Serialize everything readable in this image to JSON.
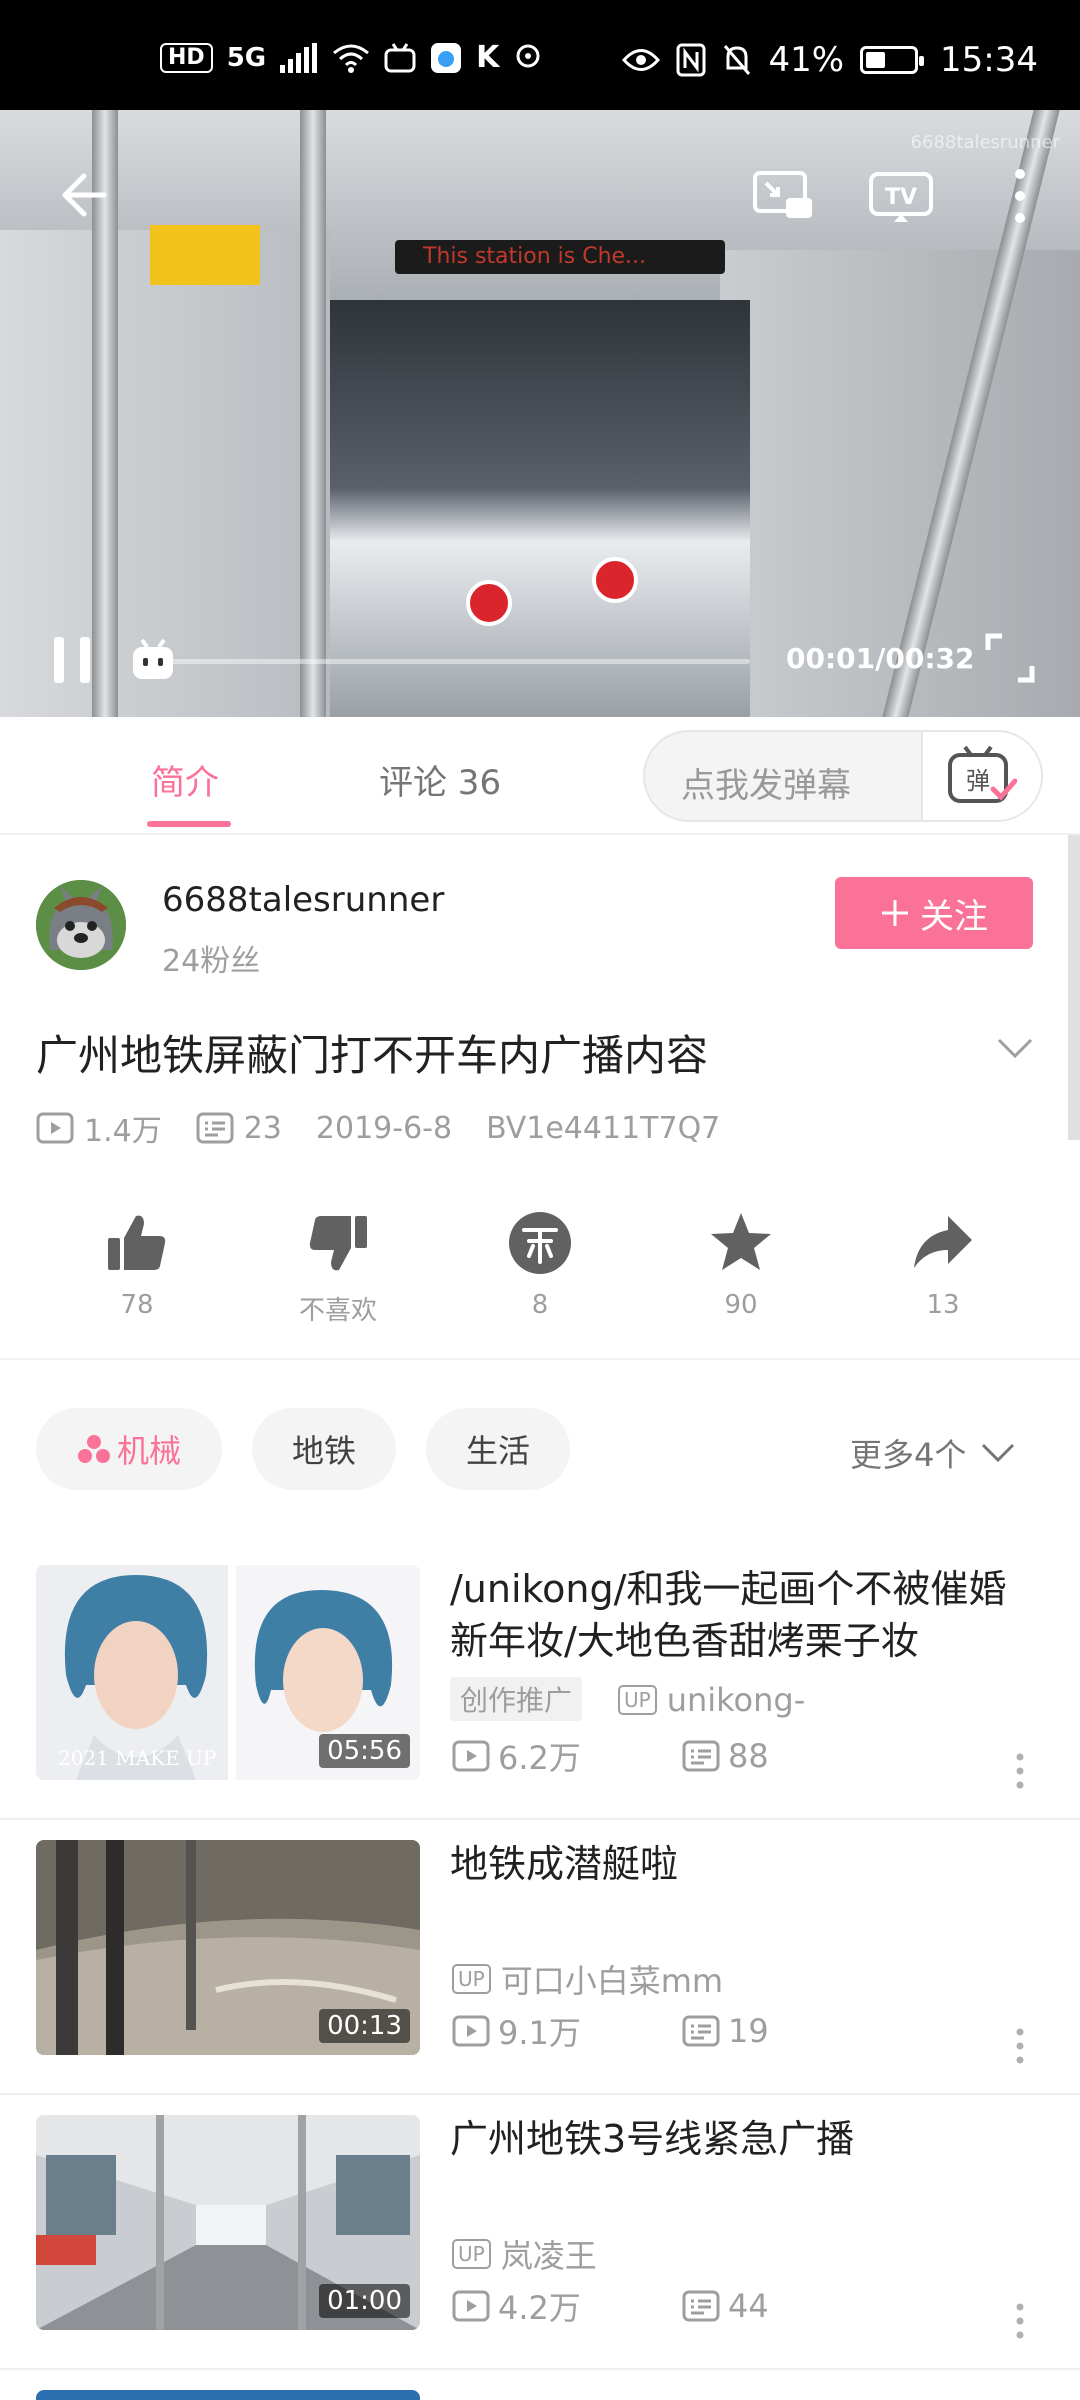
{
  "status_bar": {
    "hd": "HD",
    "network": "5G",
    "battery": "41%",
    "battery_level": 0.41,
    "time": "15:34"
  },
  "player": {
    "led_text": "This station is Che...",
    "watermark": "6688talesrunner",
    "time": "00:01/00:32",
    "progress": 0.03
  },
  "tabs": [
    {
      "label": "简介"
    },
    {
      "label": "评论 36"
    }
  ],
  "danmaku": {
    "placeholder": "点我发弹幕",
    "button": "弹"
  },
  "uploader": {
    "name": "6688talesrunner",
    "fans": "24粉丝",
    "follow": "关注"
  },
  "video": {
    "title": "广州地铁屏蔽门打不开车内广播内容",
    "views": "1.4万",
    "danmaku_count": "23",
    "date": "2019-6-8",
    "bvid": "BV1e4411T7Q7"
  },
  "actions": [
    {
      "label": "78",
      "icon": "thumbs-up-icon"
    },
    {
      "label": "不喜欢",
      "icon": "thumbs-down-icon"
    },
    {
      "label": "8",
      "icon": "coin-icon"
    },
    {
      "label": "90",
      "icon": "star-icon"
    },
    {
      "label": "13",
      "icon": "share-icon"
    }
  ],
  "tags": [
    "机械",
    "地铁",
    "生活"
  ],
  "more_tags": "更多4个",
  "recommendations": [
    {
      "title": "/unikong/和我一起画个不被催婚新年妆/大地色香甜烤栗子妆",
      "promo": "创作推广",
      "uploader": "unikong-",
      "views": "6.2万",
      "danmaku": "88",
      "duration": "05:56",
      "thumb_text": "2021 MAKE UP"
    },
    {
      "title": "地铁成潜艇啦",
      "uploader": "可口小白菜mm",
      "views": "9.1万",
      "danmaku": "19",
      "duration": "00:13"
    },
    {
      "title": "广州地铁3号线紧急广播",
      "uploader": "岚凌王",
      "views": "4.2万",
      "danmaku": "44",
      "duration": "01:00"
    }
  ],
  "up_badge": "UP",
  "colors": {
    "accent": "#fb7299",
    "text": "#212121",
    "muted": "#9e9e9e"
  }
}
